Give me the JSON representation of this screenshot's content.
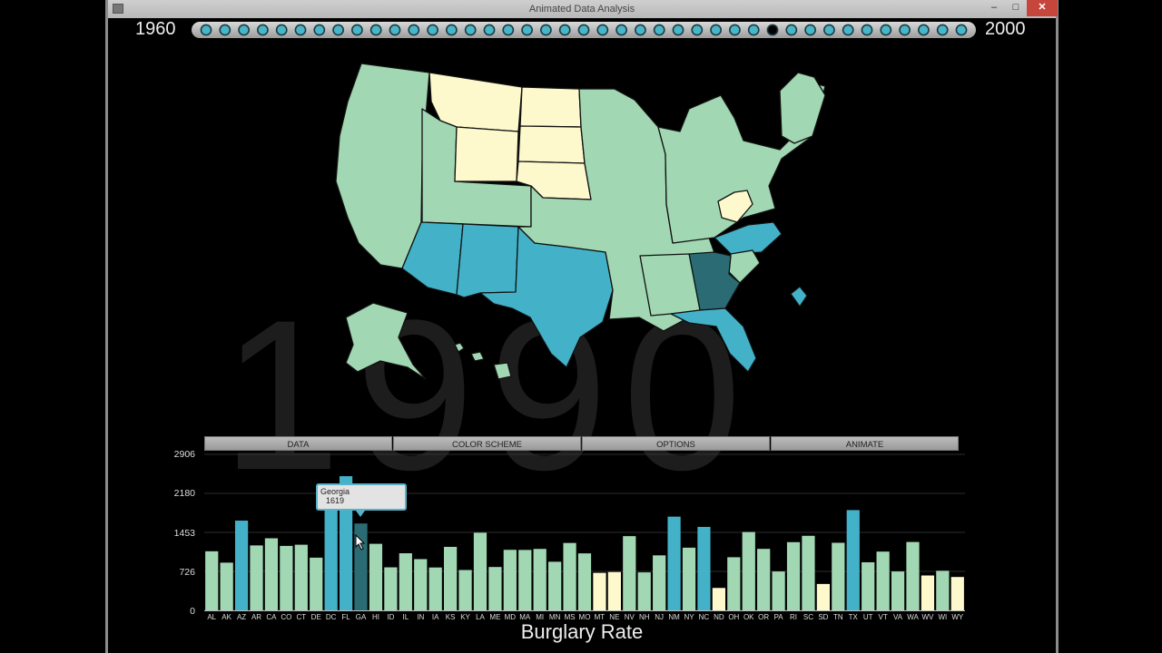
{
  "window": {
    "title": "Animated Data Analysis",
    "controls": {
      "minimize": "–",
      "maximize": "□",
      "close": "✕"
    }
  },
  "timeline": {
    "start_year": "1960",
    "end_year": "2000",
    "dot_count": 41,
    "selected_index": 30,
    "current_year": "1990"
  },
  "menu": {
    "data": "DATA",
    "color_scheme": "COLOR SCHEME",
    "options": "OPTIONS",
    "animate": "ANIMATE"
  },
  "colors": {
    "low": "#fdf9cd",
    "mid": "#a1d7b2",
    "high": "#43b2c9",
    "selected": "#2b6c74",
    "dot": "#48b6c6",
    "dot_selected": "#000000",
    "background": "#000000"
  },
  "tooltip": {
    "state": "Georgia",
    "value": "1619"
  },
  "map": {
    "highlighted_state": "Georgia",
    "low_states": [
      "Montana",
      "North Dakota",
      "South Dakota",
      "Wyoming",
      "Nebraska",
      "West Virginia"
    ],
    "high_states": [
      "Arizona",
      "New Mexico",
      "Texas",
      "North Carolina",
      "Florida",
      "District of Columbia"
    ]
  },
  "chart_data": {
    "type": "bar",
    "title": "Burglary Rate",
    "y_ticks": [
      "2906",
      "2180",
      "1453",
      "726",
      "0"
    ],
    "ylim": [
      0,
      2906
    ],
    "grid": true,
    "categories": [
      "AL",
      "AK",
      "AZ",
      "AR",
      "CA",
      "CO",
      "CT",
      "DE",
      "DC",
      "FL",
      "GA",
      "HI",
      "ID",
      "IL",
      "IN",
      "IA",
      "KS",
      "KY",
      "LA",
      "ME",
      "MD",
      "MA",
      "MI",
      "MN",
      "MS",
      "MO",
      "MT",
      "NE",
      "NV",
      "NH",
      "NJ",
      "NM",
      "NY",
      "NC",
      "ND",
      "OH",
      "OK",
      "OR",
      "PA",
      "RI",
      "SC",
      "SD",
      "TN",
      "TX",
      "UT",
      "VT",
      "VA",
      "WA",
      "WV",
      "WI",
      "WY"
    ],
    "values": [
      1101,
      889,
      1672,
      1210,
      1343,
      1201,
      1223,
      982,
      2290,
      2500,
      1619,
      1240,
      802,
      1064,
      955,
      799,
      1183,
      752,
      1447,
      808,
      1128,
      1126,
      1145,
      906,
      1256,
      1062,
      699,
      714,
      1383,
      708,
      1025,
      1746,
      1168,
      1555,
      418,
      990,
      1460,
      1146,
      725,
      1271,
      1389,
      492,
      1259,
      1868,
      896,
      1095,
      725,
      1274,
      650,
      738,
      622
    ],
    "color_class": [
      "mid",
      "mid",
      "high",
      "mid",
      "mid",
      "mid",
      "mid",
      "mid",
      "high",
      "high",
      "selected",
      "mid",
      "mid",
      "mid",
      "mid",
      "mid",
      "mid",
      "mid",
      "mid",
      "mid",
      "mid",
      "mid",
      "mid",
      "mid",
      "mid",
      "mid",
      "low",
      "low",
      "mid",
      "mid",
      "mid",
      "high",
      "mid",
      "high",
      "low",
      "mid",
      "mid",
      "mid",
      "mid",
      "mid",
      "mid",
      "low",
      "mid",
      "high",
      "mid",
      "mid",
      "mid",
      "mid",
      "low",
      "mid",
      "low"
    ]
  }
}
